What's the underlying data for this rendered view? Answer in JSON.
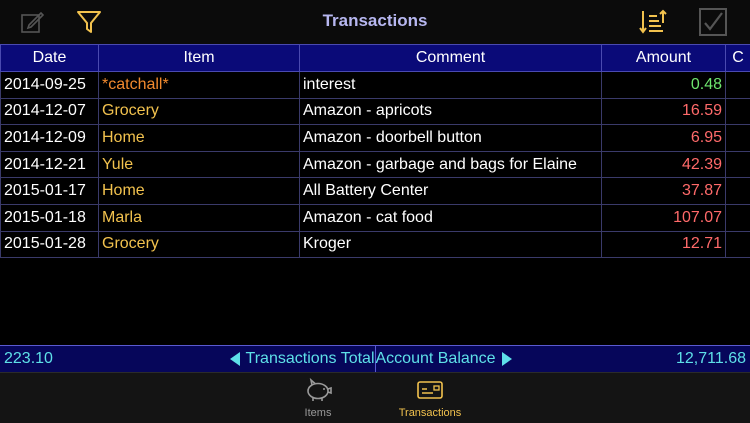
{
  "header": {
    "title": "Transactions"
  },
  "icons": {
    "edit": "pencil-square-icon",
    "filter": "funnel-icon",
    "sort": "sort-icon",
    "check": "checkbox-icon"
  },
  "columns": {
    "date": "Date",
    "item": "Item",
    "comment": "Comment",
    "amount": "Amount",
    "c": "C"
  },
  "rows": [
    {
      "date": "2014-09-25",
      "item": "*catchall*",
      "comment": "interest",
      "amount": "0.48",
      "sign": "pos"
    },
    {
      "date": "2014-12-07",
      "item": "Grocery",
      "comment": "Amazon - apricots",
      "amount": "16.59",
      "sign": "neg"
    },
    {
      "date": "2014-12-09",
      "item": "Home",
      "comment": "Amazon - doorbell button",
      "amount": "6.95",
      "sign": "neg"
    },
    {
      "date": "2014-12-21",
      "item": "Yule",
      "comment": "Amazon - garbage and bags for Elaine",
      "amount": "42.39",
      "sign": "neg"
    },
    {
      "date": "2015-01-17",
      "item": "Home",
      "comment": "All Battery Center",
      "amount": "37.87",
      "sign": "neg"
    },
    {
      "date": "2015-01-18",
      "item": "Marla",
      "comment": "Amazon - cat food",
      "amount": "107.07",
      "sign": "neg"
    },
    {
      "date": "2015-01-28",
      "item": "Grocery",
      "comment": "Kroger",
      "amount": "12.71",
      "sign": "neg"
    }
  ],
  "totals": {
    "transactions_total_value": "223.10",
    "transactions_total_label": "Transactions Total",
    "account_balance_label": "Account Balance",
    "account_balance_value": "12,711.68"
  },
  "tabs": [
    {
      "label": "Items",
      "icon": "piggy-bank-icon"
    },
    {
      "label": "Transactions",
      "icon": "credit-card-icon"
    }
  ],
  "colors": {
    "header_bg": "#0a0a78",
    "title": "#b7b7f0",
    "icon_gold": "#f2c24e",
    "item_gold": "#f2c24e",
    "catchall_orange": "#f28a2e",
    "amount_positive": "#6ee46e",
    "amount_negative": "#ff6a6a",
    "totals_text": "#5ee0e8",
    "tab_active": "#f2c24e",
    "tab_inactive": "#9a9a9a"
  }
}
